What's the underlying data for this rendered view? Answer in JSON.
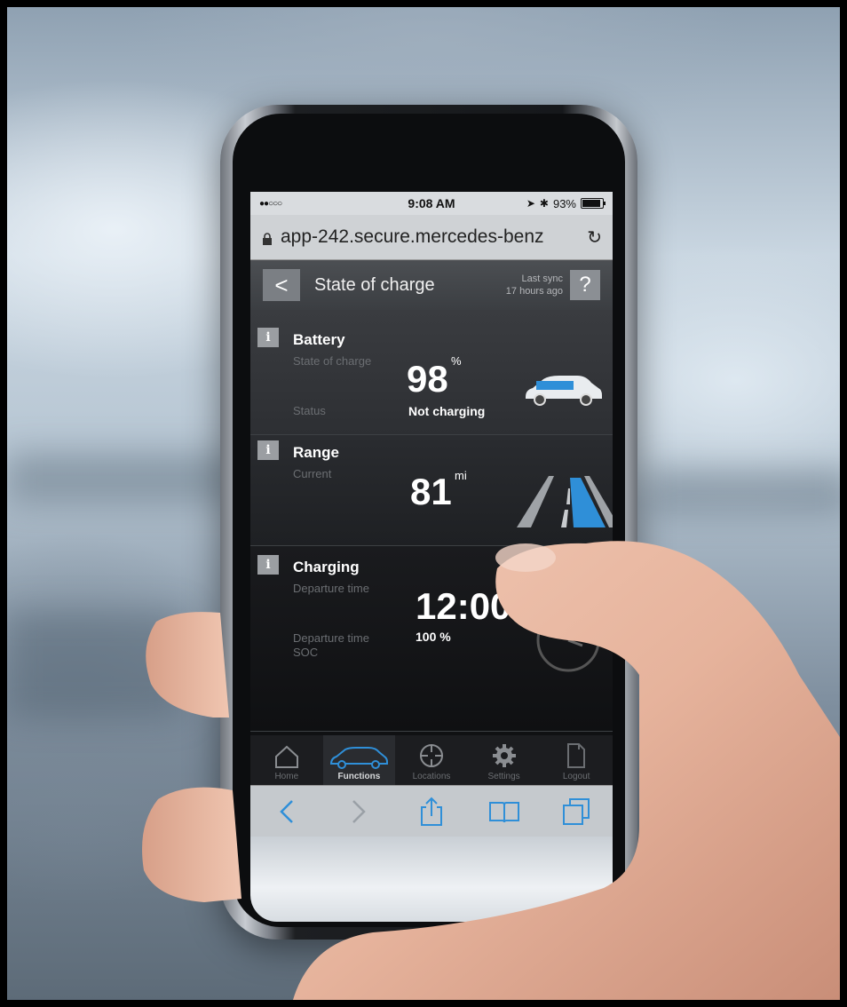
{
  "status_bar": {
    "signal": "●●○○○",
    "time": "9:08 AM",
    "battery_percent": "93%"
  },
  "url_bar": {
    "url": "app-242.secure.mercedes-benz"
  },
  "header": {
    "back": "<",
    "title": "State of charge",
    "last_sync_line1": "Last sync",
    "last_sync_line2": "17 hours ago",
    "help": "?"
  },
  "battery": {
    "info": "i",
    "title": "Battery",
    "label_soc": "State of charge",
    "value_soc": "98",
    "unit_soc": "%",
    "label_status": "Status",
    "value_status": "Not charging"
  },
  "range": {
    "info": "i",
    "title": "Range",
    "label_current": "Current",
    "value_current": "81",
    "unit_current": "mi"
  },
  "charging": {
    "info": "i",
    "title": "Charging",
    "label_departure": "Departure time",
    "value_departure": "12:00",
    "label_departure_soc_1": "Departure time",
    "label_departure_soc_2": "SOC",
    "value_departure_soc": "100 %"
  },
  "tabs": [
    {
      "label": "Home",
      "icon": "home-icon"
    },
    {
      "label": "Functions",
      "icon": "car-icon"
    },
    {
      "label": "Locations",
      "icon": "crosshair-icon"
    },
    {
      "label": "Settings",
      "icon": "gear-icon"
    },
    {
      "label": "Logout",
      "icon": "document-icon"
    }
  ],
  "active_tab": "Functions",
  "colors": {
    "accent_blue": "#2f8fd8",
    "header_bg": "#3b3e42"
  }
}
